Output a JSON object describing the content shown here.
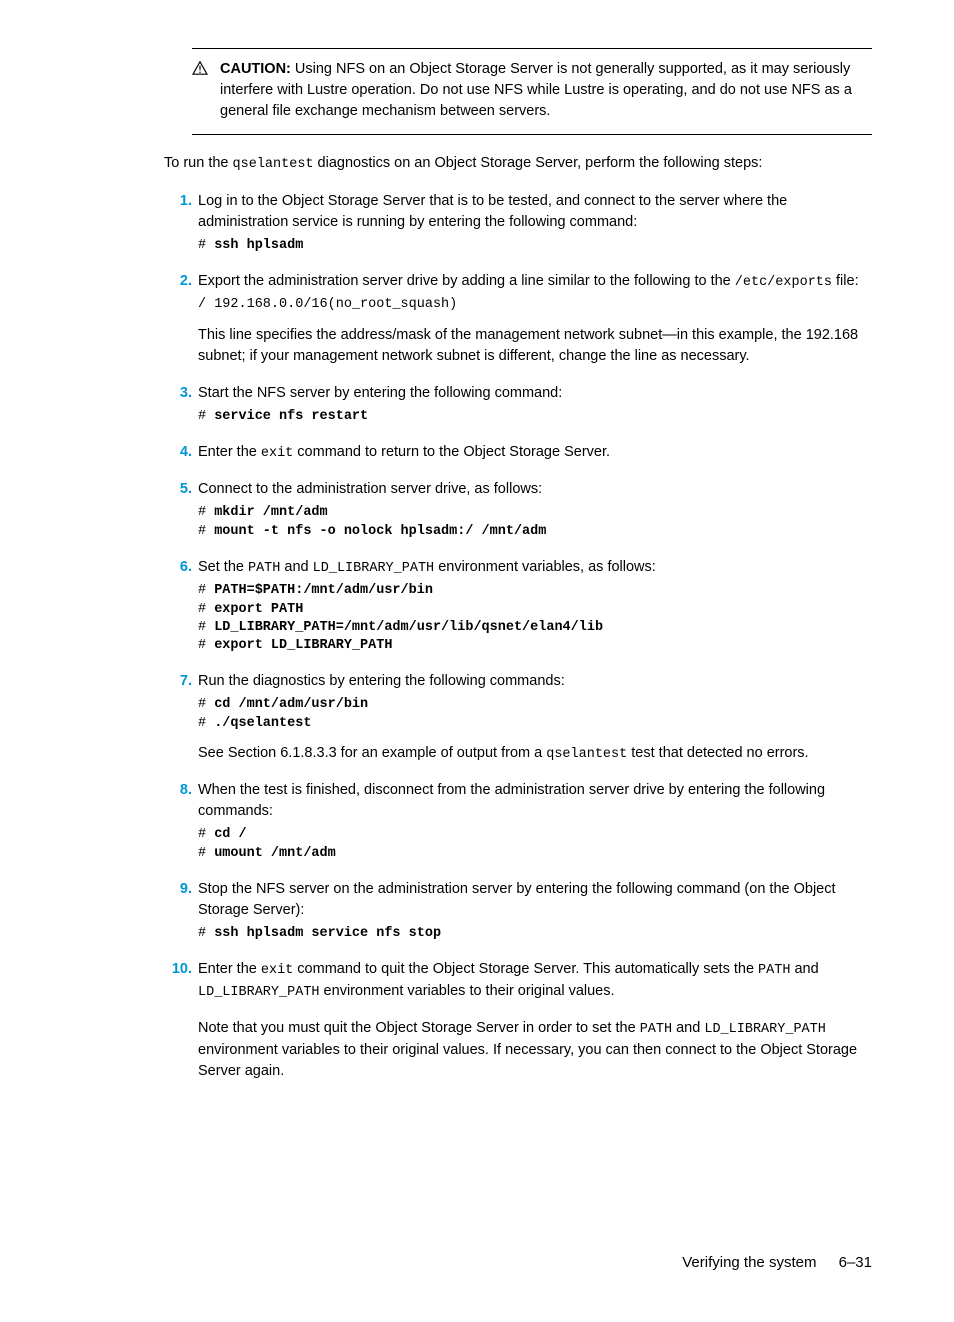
{
  "caution": {
    "label": "CAUTION:",
    "text": " Using NFS on an Object Storage Server is not generally supported, as it may seriously interfere with Lustre operation. Do not use NFS while Lustre is operating, and do not use NFS as a general file exchange mechanism between servers."
  },
  "intro": {
    "pre": "To run the ",
    "code": "qselantest",
    "post": " diagnostics on an Object Storage Server, perform the following steps:"
  },
  "step1": {
    "text": "Log in to the Object Storage Server that is to be tested, and connect to the server where the administration service is running by entering the following command:",
    "prompt": "# ",
    "cmd": "ssh hplsadm"
  },
  "step2": {
    "pre": "Export the administration server drive by adding a line similar to the following to the ",
    "code": "/etc/exports",
    "post": " file:",
    "cmd": "/ 192.168.0.0/16(no_root_squash)",
    "note": "This line specifies the address/mask of the management network subnet—in this example, the 192.168 subnet; if your management network subnet is different, change the line as necessary."
  },
  "step3": {
    "text": "Start the NFS server by entering the following command:",
    "prompt": "# ",
    "cmd": "service nfs restart"
  },
  "step4": {
    "pre": "Enter the ",
    "code": "exit",
    "post": " command to return to the Object Storage Server."
  },
  "step5": {
    "text": "Connect to the administration server drive, as follows:",
    "p1": "# ",
    "c1": "mkdir /mnt/adm",
    "p2": "# ",
    "c2": "mount -t nfs -o nolock hplsadm:/ /mnt/adm"
  },
  "step6": {
    "pre": "Set the ",
    "code1": "PATH",
    "mid": " and ",
    "code2": "LD_LIBRARY_PATH",
    "post": " environment variables, as follows:",
    "p1": "# ",
    "c1": "PATH=$PATH:/mnt/adm/usr/bin",
    "p2": "# ",
    "c2": "export PATH",
    "p3": "# ",
    "c3": "LD_LIBRARY_PATH=/mnt/adm/usr/lib/qsnet/elan4/lib",
    "p4": "# ",
    "c4": "export LD_LIBRARY_PATH"
  },
  "step7": {
    "text": "Run the diagnostics by entering the following commands:",
    "p1": "# ",
    "c1": "cd /mnt/adm/usr/bin",
    "p2": "# ",
    "c2": "./qselantest",
    "note_pre": "See Section 6.1.8.3.3 for an example of output from a ",
    "note_code": "qselantest",
    "note_post": " test that detected no errors."
  },
  "step8": {
    "text": "When the test is finished, disconnect from the administration server drive by entering the following commands:",
    "p1": "# ",
    "c1": "cd /",
    "p2": "# ",
    "c2": "umount /mnt/adm"
  },
  "step9": {
    "text": "Stop the NFS server on the administration server by entering the following command (on the Object Storage Server):",
    "prompt": "# ",
    "cmd": "ssh hplsadm service nfs stop"
  },
  "step10": {
    "p1_pre": "Enter the ",
    "p1_code1": "exit",
    "p1_mid1": " command to quit the Object Storage Server. This automatically sets the ",
    "p1_code2": "PATH",
    "p1_mid2": " and ",
    "p1_code3": "LD_LIBRARY_PATH",
    "p1_post": " environment variables to their original values.",
    "p2_pre": "Note that you must quit the Object Storage Server in order to set the ",
    "p2_code1": "PATH",
    "p2_mid": " and ",
    "p2_code2": "LD_LIBRARY_PATH",
    "p2_post": " environment variables to their original values. If necessary, you can then connect to the Object Storage Server again."
  },
  "footer": {
    "title": "Verifying the system",
    "page": "6–31"
  }
}
